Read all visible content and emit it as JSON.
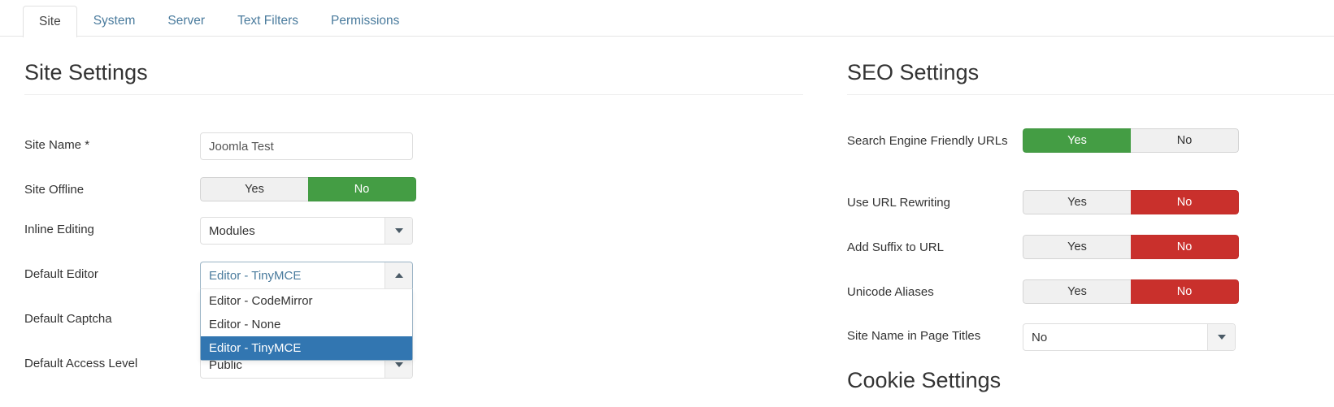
{
  "tabs": [
    {
      "label": "Site",
      "active": true
    },
    {
      "label": "System",
      "active": false
    },
    {
      "label": "Server",
      "active": false
    },
    {
      "label": "Text Filters",
      "active": false
    },
    {
      "label": "Permissions",
      "active": false
    }
  ],
  "left": {
    "heading": "Site Settings",
    "site_name": {
      "label": "Site Name *",
      "value": "Joomla Test"
    },
    "site_offline": {
      "label": "Site Offline",
      "yes_label": "Yes",
      "no_label": "No",
      "selected": "No"
    },
    "inline_editing": {
      "label": "Inline Editing",
      "value": "Modules",
      "caret": "chevron-down-icon"
    },
    "default_editor": {
      "label": "Default Editor",
      "value": "Editor - TinyMCE",
      "caret": "chevron-up-icon",
      "open": true,
      "options": [
        "Editor - CodeMirror",
        "Editor - None",
        "Editor - TinyMCE"
      ],
      "highlighted": "Editor - TinyMCE"
    },
    "default_captcha": {
      "label": "Default Captcha"
    },
    "default_access_level": {
      "label": "Default Access Level",
      "value": "Public",
      "caret": "chevron-down-icon"
    }
  },
  "right": {
    "heading": "SEO Settings",
    "cookie_heading": "Cookie Settings",
    "sef_urls": {
      "label": "Search Engine Friendly URLs",
      "yes_label": "Yes",
      "no_label": "No",
      "selected": "Yes"
    },
    "url_rewriting": {
      "label": "Use URL Rewriting",
      "yes_label": "Yes",
      "no_label": "No",
      "selected": "No"
    },
    "add_suffix": {
      "label": "Add Suffix to URL",
      "yes_label": "Yes",
      "no_label": "No",
      "selected": "No"
    },
    "unicode_aliases": {
      "label": "Unicode Aliases",
      "yes_label": "Yes",
      "no_label": "No",
      "selected": "No"
    },
    "site_name_in_titles": {
      "label": "Site Name in Page Titles",
      "value": "No",
      "caret": "chevron-down-icon"
    }
  },
  "colors": {
    "green": "#449d44",
    "red": "#c9302c",
    "blue_highlight": "#3276b1",
    "link": "#4a7b9d"
  }
}
